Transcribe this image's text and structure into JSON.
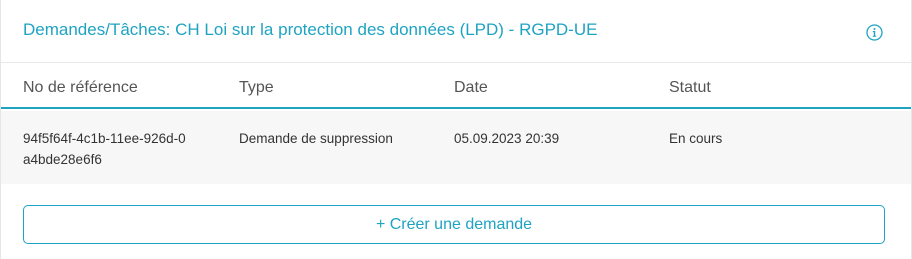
{
  "header": {
    "title": "Demandes/Tâches: CH Loi sur la protection des données (LPD) - RGPD-UE",
    "info_icon": "info-circle-icon"
  },
  "table": {
    "columns": [
      "No de référence",
      "Type",
      "Date",
      "Statut"
    ],
    "rows": [
      {
        "reference": "94f5f64f-4c1b-11ee-926d-0a4bde28e6f6",
        "type": "Demande de suppression",
        "date": "05.09.2023 20:39",
        "status": "En cours"
      }
    ]
  },
  "actions": {
    "create_label": "+ Créer une demande"
  },
  "colors": {
    "accent": "#1fa3c2",
    "row_background": "#f7f7f7"
  }
}
